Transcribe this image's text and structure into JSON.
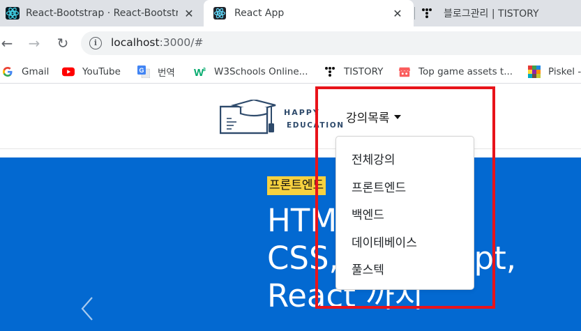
{
  "browser": {
    "tabs": [
      {
        "title": "React-Bootstrap · React-Bootstrap",
        "close": "✕",
        "favicon": "react-bootstrap-icon",
        "active": false
      },
      {
        "title": "React App",
        "close": "✕",
        "favicon": "react-icon",
        "active": true
      },
      {
        "title": "블로그관리 | TISTORY",
        "favicon": "tistory-icon",
        "active": false
      }
    ],
    "nav": {
      "back": "←",
      "forward": "→",
      "reload": "↻"
    },
    "info_icon": "i",
    "url": {
      "host": "localhost",
      "path": ":3000/#"
    },
    "bookmarks": [
      {
        "label": "Gmail",
        "icon": "google-icon"
      },
      {
        "label": "YouTube",
        "icon": "youtube-icon"
      },
      {
        "label": "번역",
        "icon": "google-translate-icon"
      },
      {
        "label": "W3Schools Online...",
        "icon": "w3schools-icon"
      },
      {
        "label": "TISTORY",
        "icon": "tistory-icon"
      },
      {
        "label": "Top game assets t...",
        "icon": "itchio-icon"
      },
      {
        "label": "Piskel -",
        "icon": "piskel-icon"
      }
    ]
  },
  "page": {
    "logo": {
      "line1": "HAPPY",
      "line2": "EDUCATION"
    },
    "nav_dropdown_label": "강의목록",
    "dropdown_items": [
      "전체강의",
      "프론트엔드",
      "백엔드",
      "데이테베이스",
      "풀스텍"
    ],
    "carousel": {
      "badge": "프론트엔드",
      "title": "HTML,\nCSS, JavaScript,\nReact 까지",
      "prev_arrow": "‹"
    }
  },
  "colors": {
    "carousel_bg": "#0369d1",
    "badge_bg": "#f7d13f",
    "annotation": "#e8131a",
    "logo": "#2e4a6b"
  }
}
